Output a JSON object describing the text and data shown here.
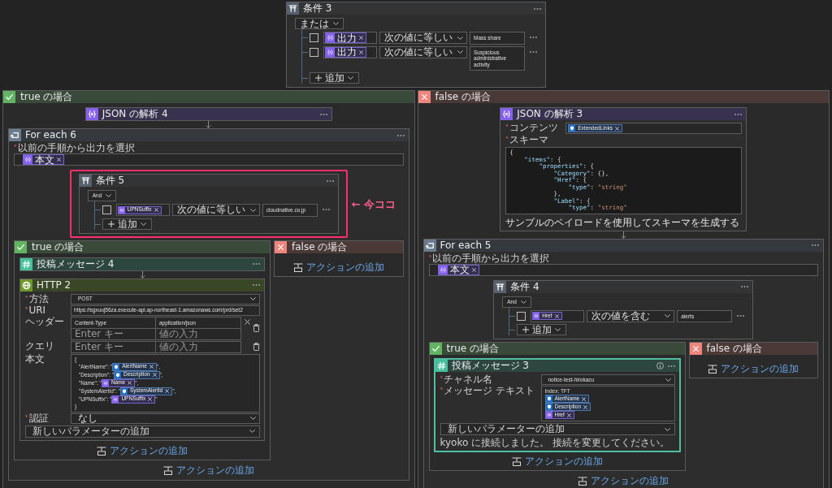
{
  "actions": [
    {
      "kind": "condition",
      "title": "条件 3",
      "selected": false,
      "operator": "または",
      "add_label": "追加",
      "rows": [
        {
          "checked": false,
          "token": {
            "kind": "variable",
            "label": "出力"
          },
          "comparison": "次の値に等しい",
          "value": "Mass share"
        },
        {
          "checked": false,
          "token": {
            "kind": "variable",
            "label": "出力"
          },
          "comparison": "次の値に等しい",
          "value": "Suspicious administrative activity"
        }
      ],
      "branches": [
        {
          "kind": "true",
          "title": "true の場合",
          "actions": [
            {
              "kind": "parse_json",
              "title": "JSON の解析 4",
              "selected": false
            },
            {
              "kind": "foreach",
              "title": "For each 6",
              "selected": false,
              "source_label": "$^{*}$以前の手順から出力を選択",
              "source": [
                {
                  "kind": "variable",
                  "label": "本文"
                }
              ],
              "add_action": "アクションの追加",
              "actions": [
                {
                  "kind": "condition",
                  "title": "条件 5",
                  "selected": false,
                  "highlight": {
                    "note": "← 今ココ"
                  },
                  "operator": "And",
                  "add_label": "追加",
                  "rows": [
                    {
                      "checked": false,
                      "token": {
                        "kind": "variable",
                        "label": "UPNSuffix"
                      },
                      "comparison": "次の値に等しい",
                      "value": "cloudnative.co.jp"
                    }
                  ],
                  "branches": [
                    {
                      "kind": "true",
                      "title": "true の場合",
                      "add_action": "アクションの追加",
                      "actions": [
                        {
                          "kind": "post_message",
                          "title": "投稿メッセージ 4",
                          "selected": false
                        },
                        {
                          "kind": "http",
                          "title": "HTTP 2",
                          "selected": false,
                          "fields": [
                            {
                              "kind": "dropdown",
                              "label": "$^{*}$方法",
                              "value": "POST"
                            },
                            {
                              "kind": "text",
                              "label": "$^{*}$URI",
                              "value": "https://sgxuuj56za.execute-api.ap-northeast-1.amazonaws.com/prd/set2"
                            },
                            {
                              "kind": "pairs",
                              "label": "ヘッダー",
                              "rows": [
                                {
                                  "removable": true,
                                  "key": {
                                    "value": "Content-Type"
                                  },
                                  "value": {
                                    "value": "application/json"
                                  }
                                },
                                {
                                  "removable": false,
                                  "key": {
                                    "placeholder": "Enter キー"
                                  },
                                  "value": {
                                    "placeholder": "値の入力"
                                  }
                                }
                              ]
                            },
                            {
                              "kind": "pairs",
                              "label": "クエリ",
                              "rows": [
                                {
                                  "removable": false,
                                  "key": {
                                    "placeholder": "Enter キー"
                                  },
                                  "value": {
                                    "placeholder": "値の入力"
                                  }
                                }
                              ]
                            },
                            {
                              "kind": "json_body",
                              "label": "本文",
                              "lines": [
                                {
                                  "parts": [
                                    {
                                      "kind": "text",
                                      "text": "{"
                                    }
                                  ]
                                },
                                {
                                  "parts": [
                                    {
                                      "kind": "text",
                                      "text": "\"AlertName\": \""
                                    },
                                    {
                                      "kind": "alert",
                                      "label": "AlertName"
                                    },
                                    {
                                      "kind": "text",
                                      "text": "\","
                                    }
                                  ]
                                },
                                {
                                  "parts": [
                                    {
                                      "kind": "text",
                                      "text": "\"Description\": \""
                                    },
                                    {
                                      "kind": "alert",
                                      "label": "Description"
                                    },
                                    {
                                      "kind": "text",
                                      "text": "\","
                                    }
                                  ]
                                },
                                {
                                  "parts": [
                                    {
                                      "kind": "text",
                                      "text": "\"Name\": \""
                                    },
                                    {
                                      "kind": "variable",
                                      "label": "Name"
                                    },
                                    {
                                      "kind": "text",
                                      "text": "\","
                                    }
                                  ]
                                },
                                {
                                  "parts": [
                                    {
                                      "kind": "text",
                                      "text": "\"SystemAlertId\": \""
                                    },
                                    {
                                      "kind": "alert",
                                      "label": "SystemAlertId"
                                    },
                                    {
                                      "kind": "text",
                                      "text": "\","
                                    }
                                  ]
                                },
                                {
                                  "parts": [
                                    {
                                      "kind": "text",
                                      "text": "\"UPNSuffix\": \""
                                    },
                                    {
                                      "kind": "variable",
                                      "label": "UPNSuffix"
                                    },
                                    {
                                      "kind": "text",
                                      "text": "\""
                                    }
                                  ]
                                },
                                {
                                  "parts": [
                                    {
                                      "kind": "text",
                                      "text": "}"
                                    }
                                  ]
                                }
                              ]
                            },
                            {
                              "kind": "dropdown",
                              "label": "$^{*}$認証",
                              "value": "なし"
                            },
                            {
                              "kind": "picker",
                              "placeholder": "新しいパラメーターの追加"
                            }
                          ]
                        }
                      ]
                    },
                    {
                      "kind": "false",
                      "title": "false の場合",
                      "add_action": "アクションの追加"
                    }
                  ]
                }
              ]
            }
          ]
        },
        {
          "kind": "false",
          "title": "false の場合",
          "actions": [
            {
              "kind": "parse_json",
              "title": "JSON の解析 3",
              "selected": false,
              "fields": [
                {
                  "kind": "tokens",
                  "label": "$^{*}$コンテンツ",
                  "tokens": [
                    {
                      "kind": "alert",
                      "label": "ExtendedLinks"
                    }
                  ]
                },
                {
                  "kind": "code",
                  "label": "$^{*}$スキーマ",
                  "lines": [
                    "{",
                    "    \"items\": {",
                    "        \"properties\": {",
                    "            \"Category\": {},",
                    "            \"Href\": {",
                    "                \"type\": \"string\"",
                    "            },",
                    "            \"Label\": {",
                    "                \"type\": \"string\""
                  ]
                },
                {
                  "kind": "link",
                  "text": "サンプルのペイロードを使用してスキーマを生成する"
                }
              ]
            },
            {
              "kind": "foreach",
              "title": "For each 5",
              "selected": false,
              "source_label": "$^{*}$以前の手順から出力を選択",
              "source": [
                {
                  "kind": "variable",
                  "label": "本文"
                }
              ],
              "add_action": "アクションの追加",
              "actions": [
                {
                  "kind": "condition",
                  "title": "条件 4",
                  "selected": false,
                  "operator": "And",
                  "add_label": "追加",
                  "rows": [
                    {
                      "checked": false,
                      "token": {
                        "kind": "variable",
                        "label": "Href"
                      },
                      "comparison": "次の値を含む",
                      "value": "alerts"
                    }
                  ],
                  "branches": [
                    {
                      "kind": "true",
                      "title": "true の場合",
                      "add_action": "アクションの追加",
                      "actions": [
                        {
                          "kind": "post_message",
                          "title": "投稿メッセージ 3",
                          "selected": true,
                          "fields": [
                            {
                              "kind": "dropdown",
                              "label": "$^{*}$チャネル名",
                              "value": "notice-test-hirokazu"
                            },
                            {
                              "kind": "message",
                              "label": "$^{*}$メッセージ テキスト",
                              "lines": [
                                {
                                  "parts": [
                                    {
                                      "kind": "text",
                                      "text": "Index: TFT"
                                    }
                                  ]
                                },
                                {
                                  "parts": [
                                    {
                                      "kind": "alert",
                                      "label": "AlertName"
                                    }
                                  ]
                                },
                                {
                                  "parts": [
                                    {
                                      "kind": "alert",
                                      "label": "Description"
                                    }
                                  ]
                                },
                                {
                                  "parts": [
                                    {
                                      "kind": "variable",
                                      "label": "Href"
                                    }
                                  ]
                                }
                              ]
                            },
                            {
                              "kind": "picker",
                              "placeholder": "新しいパラメーターの追加"
                            },
                            {
                              "kind": "note",
                              "text": "kyoko に接続しました。 接続を変更してください。"
                            }
                          ]
                        }
                      ]
                    },
                    {
                      "kind": "false",
                      "title": "false の場合",
                      "add_action": "アクションの追加"
                    }
                  ]
                }
              ]
            }
          ]
        }
      ]
    }
  ]
}
